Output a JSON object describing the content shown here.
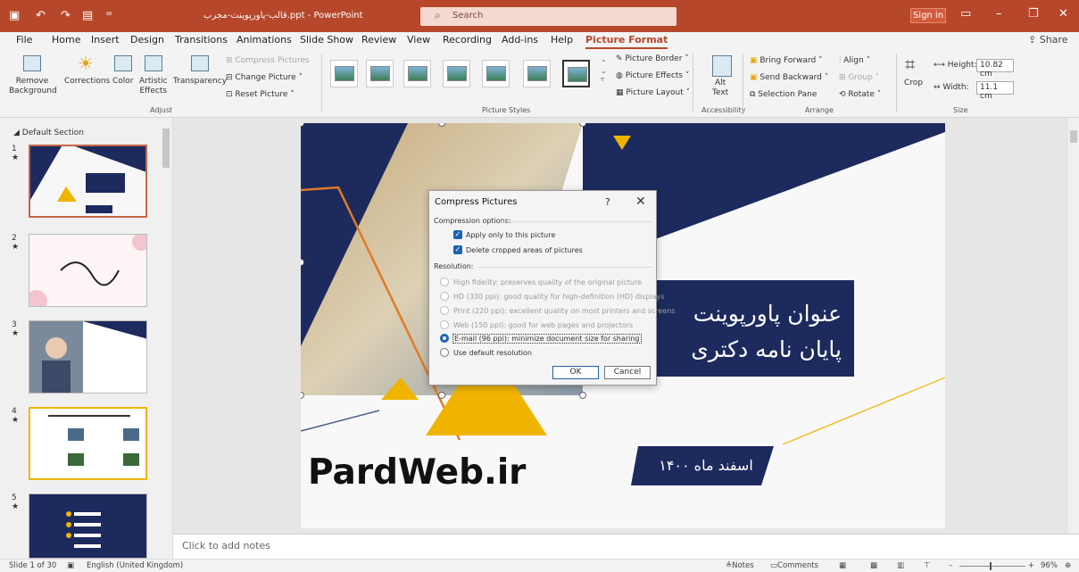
{
  "titlebar": {
    "doc_title": "قالب-پاورپوینت-مجرب.ppt - PowerPoint",
    "search_placeholder": "Search",
    "sign_in": "Sign in",
    "bg_color": "#b7472a"
  },
  "menu": {
    "tabs": [
      "File",
      "Home",
      "Insert",
      "Design",
      "Transitions",
      "Animations",
      "Slide Show",
      "Review",
      "View",
      "Recording",
      "Add-ins",
      "Help",
      "Picture Format"
    ],
    "active": "Picture Format",
    "share": "Share"
  },
  "ribbon": {
    "remove_bg": "Remove\nBackground",
    "corrections": "Corrections",
    "color": "Color",
    "artistic": "Artistic\nEffects",
    "transparency": "Transparency",
    "compress": "Compress Pictures",
    "change": "Change Picture",
    "reset": "Reset Picture",
    "adjust_group": "Adjust",
    "picture_border": "Picture Border",
    "picture_effects": "Picture Effects",
    "picture_layout": "Picture Layout",
    "styles_group": "Picture Styles",
    "alt_text": "Alt\nText",
    "accessibility_group": "Accessibility",
    "bring_forward": "Bring Forward",
    "send_backward": "Send Backward",
    "selection_pane": "Selection Pane",
    "align": "Align",
    "group": "Group",
    "rotate": "Rotate",
    "arrange_group": "Arrange",
    "crop": "Crop",
    "height_label": "Height:",
    "height_value": "10.82 cm",
    "width_label": "Width:",
    "width_value": "11.1 cm",
    "size_group": "Size"
  },
  "thumbnails": {
    "section": "Default Section",
    "slides": [
      {
        "num": "1"
      },
      {
        "num": "2"
      },
      {
        "num": "3"
      },
      {
        "num": "4"
      },
      {
        "num": "5"
      }
    ]
  },
  "slide": {
    "title_line1": "عنوان پاورپوینت",
    "title_line2": "پایان نامه دکتری",
    "date": "اسفند ماه ۱۴۰۰",
    "brand": "PardWeb.ir",
    "navy": "#1d2a5e",
    "yellow": "#f0b400",
    "orange": "#e07b25"
  },
  "dialog": {
    "title": "Compress Pictures",
    "help": "?",
    "compression_options": "Compression options:",
    "apply_only": "Apply only to this picture",
    "delete_cropped": "Delete cropped areas of pictures",
    "resolution": "Resolution:",
    "options": [
      {
        "label": "High fidelity: preserves quality of the original picture",
        "enabled": false
      },
      {
        "label": "HD (330 ppi): good quality for high-definition (HD) displays",
        "enabled": false
      },
      {
        "label": "Print (220 ppi): excellent quality on most printers and screens",
        "enabled": false
      },
      {
        "label": "Web (150 ppi): good for web pages and projectors",
        "enabled": false
      },
      {
        "label": "E-mail (96 ppi): minimize document size for sharing",
        "enabled": true,
        "selected": true
      },
      {
        "label": "Use default resolution",
        "enabled": true
      }
    ],
    "ok": "OK",
    "cancel": "Cancel"
  },
  "notes_placeholder": "Click to add notes",
  "status": {
    "slide_info": "Slide 1 of 30",
    "language": "English (United Kingdom)",
    "notes": "Notes",
    "comments": "Comments",
    "zoom": "96%"
  }
}
